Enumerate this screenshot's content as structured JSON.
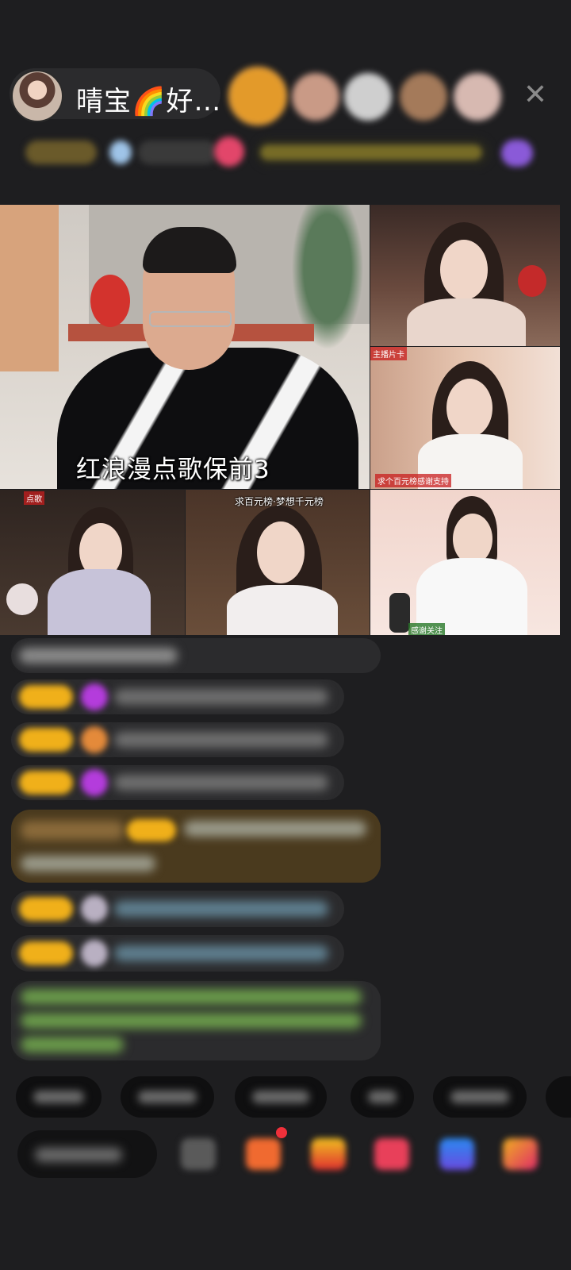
{
  "header": {
    "host_name": "晴宝🌈好…",
    "close_label": "✕"
  },
  "video": {
    "main_caption": "红浪漫点歌保前3",
    "tile_b2_caption": "求百元榜·梦想千元榜",
    "tile_r2_tag_top": "主播片卡",
    "tile_r2_tag_bottom": "求个百元榜感谢支持",
    "tile_b3_tag": "感谢关注",
    "tile_b1_tag": "点歌"
  },
  "colors": {
    "background": "#1e1e20",
    "level_badge": "#f0b01a",
    "chat_bubble": "#2a2a2c",
    "highlight_bubble": "#4a3a1e"
  },
  "icons": [
    "close-icon",
    "gift-icon",
    "shop-icon",
    "red-packet-icon",
    "game-icon",
    "more-icon"
  ]
}
